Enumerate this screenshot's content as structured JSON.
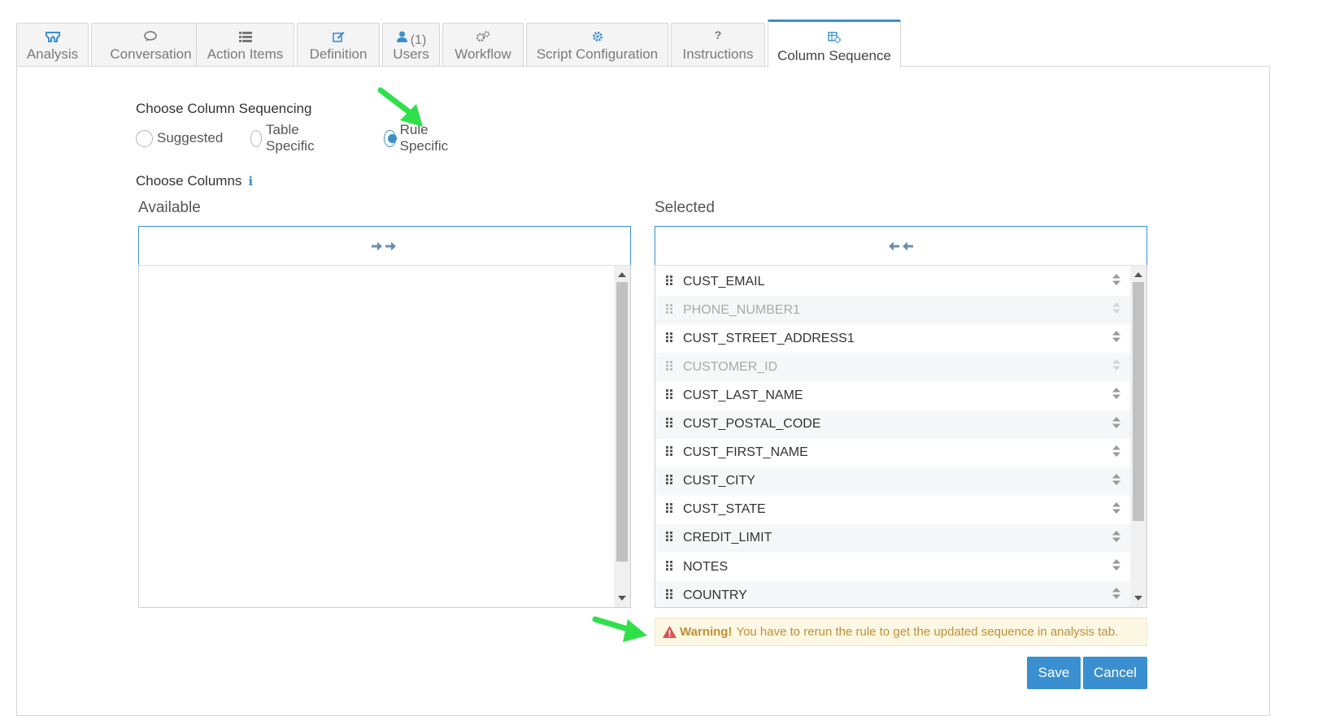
{
  "tabs": [
    {
      "label": "Analysis",
      "icon": "binoculars-icon"
    },
    {
      "label": "Conversation",
      "icon": "comments-icon"
    },
    {
      "label": "Action Items",
      "icon": "list-icon"
    },
    {
      "label": "Definition",
      "icon": "edit-icon"
    },
    {
      "label": "Users",
      "icon": "user-icon",
      "count": "(1)"
    },
    {
      "label": "Workflow",
      "icon": "cogs-icon"
    },
    {
      "label": "Script Configuration",
      "icon": "gear-icon"
    },
    {
      "label": "Instructions",
      "icon": "question-icon"
    },
    {
      "label": "Column Sequence",
      "icon": "table-settings-icon",
      "active": true
    }
  ],
  "sequencing": {
    "label": "Choose Column Sequencing",
    "options": [
      "Suggested",
      "Table Specific",
      "Rule Specific"
    ],
    "selected": "Rule Specific"
  },
  "columns": {
    "label": "Choose Columns",
    "available_title": "Available",
    "selected_title": "Selected",
    "available_items": [],
    "selected_items": [
      {
        "name": "CUST_EMAIL",
        "disabled": false
      },
      {
        "name": "PHONE_NUMBER1",
        "disabled": true
      },
      {
        "name": "CUST_STREET_ADDRESS1",
        "disabled": false
      },
      {
        "name": "CUSTOMER_ID",
        "disabled": true
      },
      {
        "name": "CUST_LAST_NAME",
        "disabled": false
      },
      {
        "name": "CUST_POSTAL_CODE",
        "disabled": false
      },
      {
        "name": "CUST_FIRST_NAME",
        "disabled": false
      },
      {
        "name": "CUST_CITY",
        "disabled": false
      },
      {
        "name": "CUST_STATE",
        "disabled": false
      },
      {
        "name": "CREDIT_LIMIT",
        "disabled": false
      },
      {
        "name": "NOTES",
        "disabled": false
      },
      {
        "name": "COUNTRY",
        "disabled": false
      }
    ]
  },
  "warning": {
    "title": "Warning!",
    "message": "You have to rerun the rule to get the updated sequence in analysis tab."
  },
  "buttons": {
    "save": "Save",
    "cancel": "Cancel"
  },
  "colors": {
    "accent": "#3a8fd0",
    "warning_bg": "#fcf8e3",
    "warning_text": "#c0903b",
    "annotation_arrow": "#2fe04a"
  }
}
